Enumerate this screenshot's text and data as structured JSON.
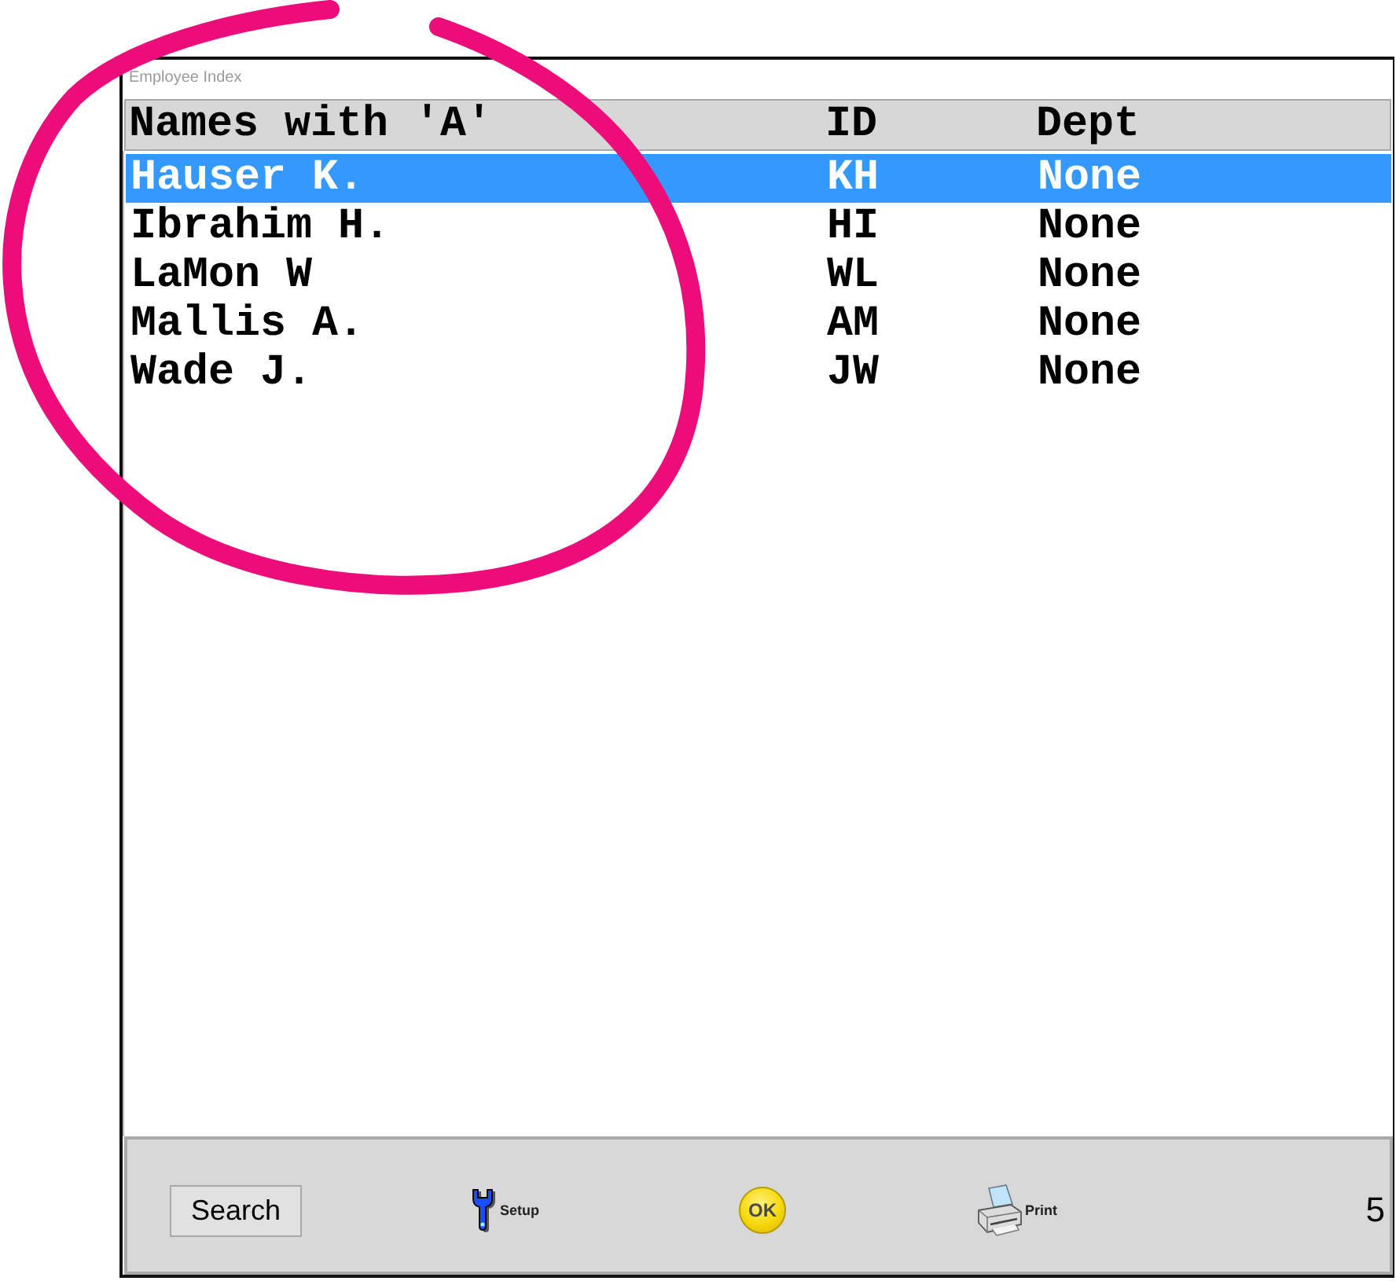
{
  "window": {
    "title": "Employee Index"
  },
  "table": {
    "columns": [
      {
        "label": "Names with 'A'"
      },
      {
        "label": "ID"
      },
      {
        "label": "Dept"
      }
    ],
    "rows": [
      {
        "cells": [
          "Hauser K.",
          "KH",
          "None"
        ],
        "selected": true
      },
      {
        "cells": [
          "Ibrahim H.",
          "HI",
          "None"
        ],
        "selected": false
      },
      {
        "cells": [
          "LaMon W",
          "WL",
          "None"
        ],
        "selected": false
      },
      {
        "cells": [
          "Mallis A.",
          "AM",
          "None"
        ],
        "selected": false
      },
      {
        "cells": [
          "Wade J.",
          "JW",
          "None"
        ],
        "selected": false
      }
    ]
  },
  "toolbar": {
    "buttons": [
      {
        "kind": "search",
        "label": "Search"
      },
      {
        "kind": "setup",
        "label": "Setup"
      },
      {
        "kind": "ok",
        "label": "OK"
      },
      {
        "kind": "print",
        "label": "Print"
      }
    ],
    "record_count": "5"
  }
}
